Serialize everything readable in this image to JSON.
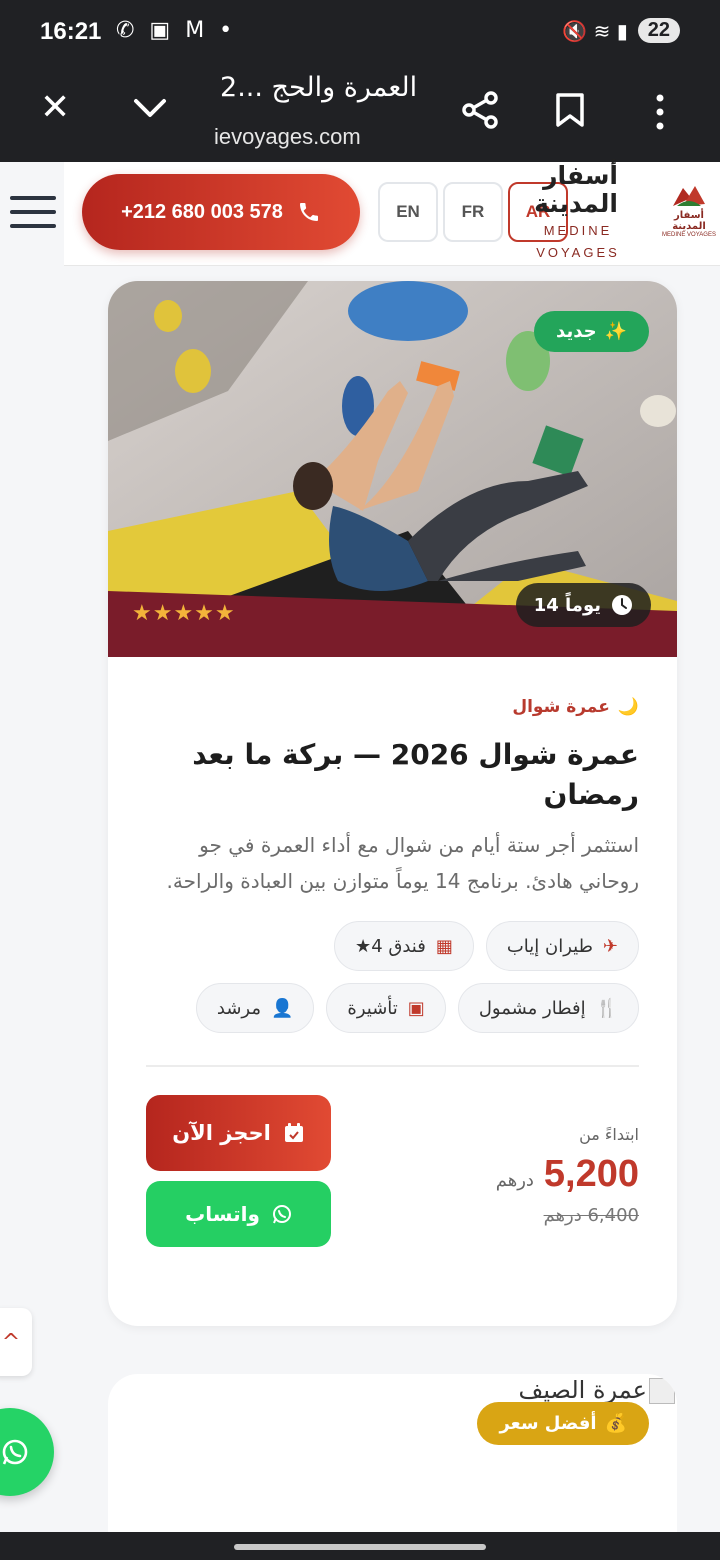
{
  "status": {
    "time": "16:21",
    "left_icons": "✆ ▣ M •",
    "signal": "🔇 ≋ ▮",
    "battery": "22"
  },
  "browser": {
    "title": "العمرة والحج ...2",
    "url": "ievoyages.com",
    "icons": [
      "close-icon",
      "chevron-down-icon",
      "share-icon",
      "bookmark-icon",
      "more-icon"
    ]
  },
  "header": {
    "phone": "+212 680 003 578",
    "langs": {
      "en": "EN",
      "fr": "FR",
      "ar": "AR"
    },
    "brand_ar": "أسفار المدينة",
    "brand_en": "MEDINE VOYAGES",
    "logo_ar": "أسفار المدينة",
    "logo_en": "MEDINE VOYAGES",
    "accent": "#c0392b"
  },
  "card": {
    "badge_new": "جديد",
    "badge_new_icon": "✨",
    "duration": "14 يوماً",
    "stars": "★★★★★",
    "rating": 5,
    "category_icon": "🌙",
    "category": "عمرة شوال",
    "title": "عمرة شوال 2026 — بركة ما بعد رمضان",
    "description": "استثمر أجر ستة أيام من شوال مع أداء العمرة في جو روحاني هادئ. برنامج 14 يوماً متوازن بين العبادة والراحة.",
    "chips": [
      {
        "icon": "✈",
        "label": "طيران إياب"
      },
      {
        "icon": "▦",
        "label": "فندق 4★"
      },
      {
        "icon": "🍴",
        "label": "إفطار مشمول"
      },
      {
        "icon": "▣",
        "label": "تأشيرة"
      },
      {
        "icon": "👤",
        "label": "مرشد"
      }
    ],
    "price_from": "ابتداءً من",
    "price": "5,200",
    "currency": "درهم",
    "old_price": "6,400 درهم",
    "book_label": "احجز الآن",
    "whatsapp_label": "واتساب"
  },
  "card2": {
    "title": "عمرة الصيف",
    "badge_best": "أفضل سعر",
    "badge_best_icon": "💰"
  },
  "floating": {
    "scroll_top_icon": "^"
  }
}
